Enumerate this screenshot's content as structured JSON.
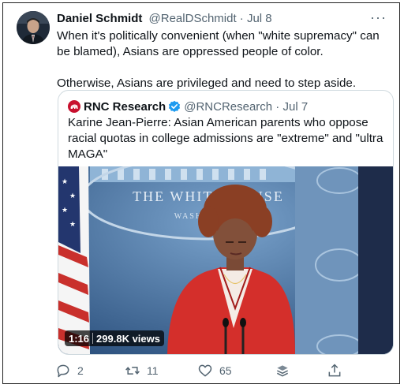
{
  "tweet": {
    "author_name": "Daniel Schmidt",
    "handle_and_date": "@RealDSchmidt · Jul 8",
    "more_label": "···",
    "paragraphs": [
      "When it's politically convenient (when \"white supremacy\" can be blamed), Asians are oppressed people of color.",
      "Otherwise, Asians are privileged and need to step aside."
    ]
  },
  "quote": {
    "author_name": "RNC Research",
    "handle_and_date": "@RNCResearch · Jul 7",
    "text": "Karine Jean-Pierre: Asian American parents who oppose racial quotas in college admissions are \"extreme\" and \"ultra MAGA\"",
    "video": {
      "duration": "1:16",
      "views": "299.8K views",
      "backdrop_seal_text": "THE WHITE HOUSE",
      "backdrop_seal_subtext": "WASHINGTON"
    }
  },
  "actions": {
    "reply_count": "2",
    "retweet_count": "11",
    "like_count": "65"
  },
  "icons": {
    "reply": "reply-icon",
    "retweet": "retweet-icon",
    "like": "heart-icon",
    "stack": "layers-icon",
    "share": "share-icon",
    "verified": "verified-badge-icon"
  },
  "colors": {
    "text": "#0f1419",
    "secondary": "#536471",
    "verified": "#1d9bf0",
    "rnc_red": "#c8102e",
    "border": "#cfd9de"
  }
}
